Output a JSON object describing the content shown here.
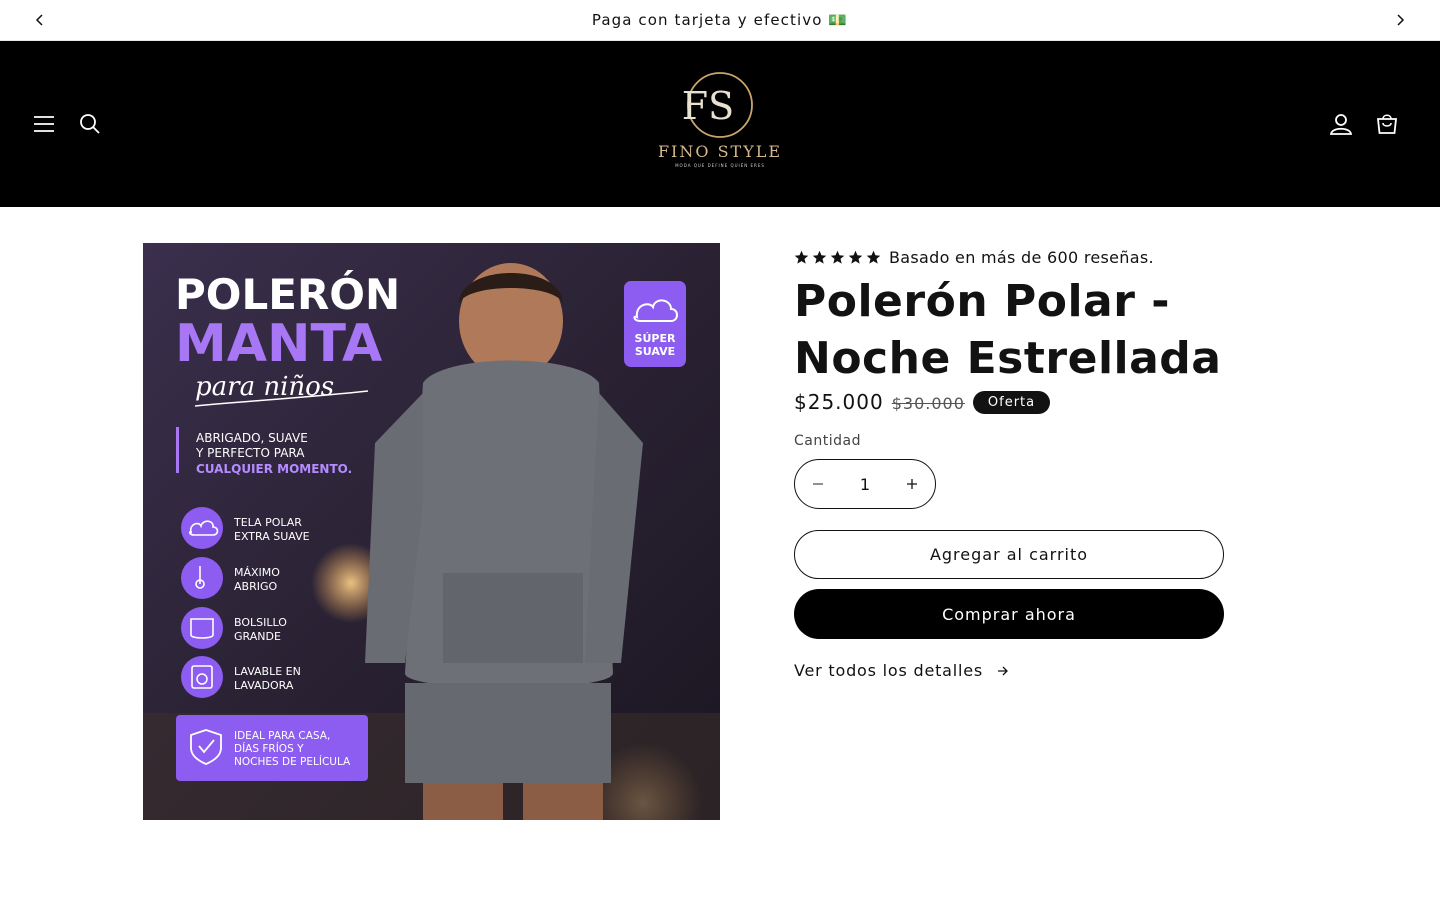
{
  "announcement": {
    "message": "Paga con tarjeta y efectivo 💵",
    "prev_icon": "chevron-left-icon",
    "next_icon": "chevron-right-icon"
  },
  "header": {
    "brand": "FINO STYLE",
    "tagline": "MODA QUE DEFINE QUIÉN ERES",
    "logo_monogram": "FS",
    "icons": [
      "menu-icon",
      "search-icon",
      "account-icon",
      "cart-icon"
    ]
  },
  "product": {
    "rating_stars": 5,
    "rating_text": "Basado en más de 600 reseñas.",
    "title": "Polerón Polar - Noche Estrellada",
    "price": "$25.000",
    "compare_price": "$30.000",
    "badge": "Oferta",
    "quantity_label": "Cantidad",
    "quantity": "1",
    "add_to_cart": "Agregar al carrito",
    "buy_now": "Comprar ahora",
    "details_link": "Ver todos los detalles"
  },
  "media": {
    "heading_line1": "POLERÓN",
    "heading_line2": "MANTA",
    "heading_line3": "para niños",
    "intro_line1": "ABRIGADO, SUAVE",
    "intro_line2": "Y PERFECTO PARA",
    "intro_line3": "CUALQUIER MOMENTO.",
    "badge_line1": "SÚPER",
    "badge_line2": "SUAVE",
    "features": [
      {
        "line1": "TELA POLAR",
        "line2": "EXTRA SUAVE"
      },
      {
        "line1": "MÁXIMO",
        "line2": "ABRIGO"
      },
      {
        "line1": "BOLSILLO",
        "line2": "GRANDE"
      },
      {
        "line1": "LAVABLE EN",
        "line2": "LAVADORA"
      }
    ],
    "banner_line1": "IDEAL PARA CASA,",
    "banner_line2": "DÍAS FRÍOS Y",
    "banner_line3": "NOCHES DE PELÍCULA"
  },
  "colors": {
    "header_bg": "#000000",
    "logo_gold": "#d7b98a",
    "accent_purple": "#8b5cf6",
    "text": "#121212"
  }
}
